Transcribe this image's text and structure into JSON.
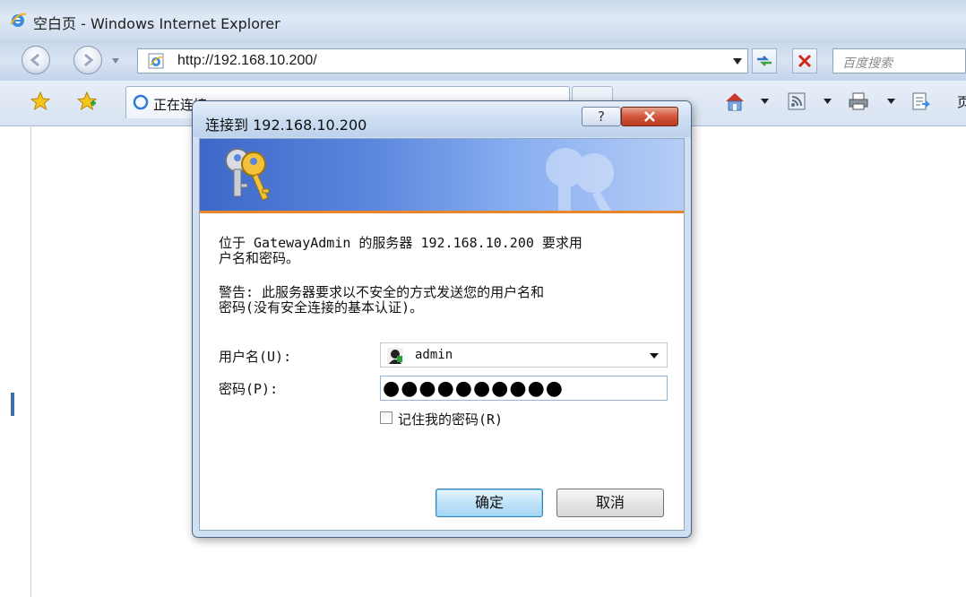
{
  "browser": {
    "window_title": "空白页 - Windows Internet Explorer",
    "address": "http://192.168.10.200/",
    "search_placeholder": "百度搜索",
    "tab_label": "正在连接...",
    "command_bar_text": "页"
  },
  "dialog": {
    "title": "连接到 192.168.10.200",
    "help_label": "?",
    "message_line1": "位于 GatewayAdmin 的服务器 192.168.10.200 要求用",
    "message_line1b": "户名和密码。",
    "warning_line1": "警告: 此服务器要求以不安全的方式发送您的用户名和",
    "warning_line2": "密码(没有安全连接的基本认证)。",
    "username_label": "用户名(U):",
    "password_label": "密码(P):",
    "username_value": "admin",
    "password_mask": "●●●●●●●●●●",
    "remember_label": "记住我的密码(R)",
    "remember_checked": false,
    "ok_label": "确定",
    "cancel_label": "取消"
  },
  "icons": {
    "window": "ie-logo-icon",
    "back": "back-arrow-icon",
    "forward": "forward-arrow-icon",
    "page": "ie-page-icon",
    "refresh": "refresh-icon",
    "stop": "stop-icon",
    "favorites": "favorites-star-icon",
    "add_favorites": "add-favorites-icon",
    "loading": "loading-icon",
    "home": "home-icon",
    "feeds": "feeds-icon",
    "print": "print-icon",
    "page_menu": "page-menu-icon",
    "keys": "keys-icon",
    "user": "user-icon"
  },
  "colors": {
    "banner_start": "#3d68c9",
    "banner_end": "#b5cdf6",
    "banner_underline": "#e8862a",
    "close_button": "#d3553a",
    "ok_button": "#bfe3f8"
  }
}
